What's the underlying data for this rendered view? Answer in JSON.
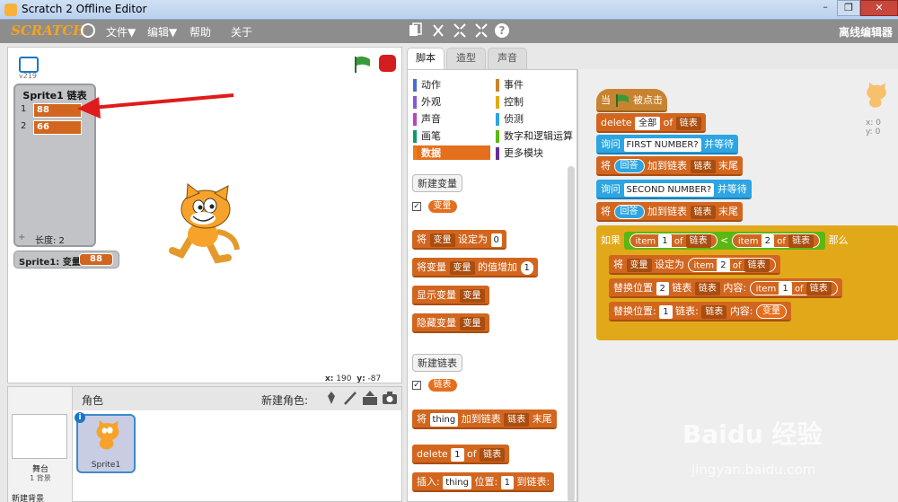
{
  "window": {
    "title": "Scratch 2 Offline Editor",
    "controls": [
      "–",
      "❐",
      "✕"
    ]
  },
  "menubar": {
    "logo": "SCRATCH",
    "items": [
      "文件▼",
      "编辑▼",
      "帮助",
      "关于"
    ],
    "right_label": "离线编辑器"
  },
  "stage": {
    "version": "v219",
    "list_watcher": {
      "title": "Sprite1 链表",
      "items": [
        {
          "index": "1",
          "value": "88"
        },
        {
          "index": "2",
          "value": "66"
        }
      ],
      "footer_plus": "+",
      "length_label": "长度: 2"
    },
    "var_watcher": {
      "name": "Sprite1: 变量",
      "value": "88"
    },
    "mouse_x_label": "x:",
    "mouse_x": "190",
    "mouse_y_label": "y:",
    "mouse_y": "-87"
  },
  "sprites_panel": {
    "title": "角色",
    "new_sprite_label": "新建角色:",
    "stage_label": "舞台",
    "stage_sub": "1 背景",
    "new_backdrop": "新建背景",
    "sprite_name": "Sprite1",
    "info_icon": "i"
  },
  "tabs": [
    {
      "label": "脚本",
      "active": true
    },
    {
      "label": "造型",
      "active": false
    },
    {
      "label": "声音",
      "active": false
    }
  ],
  "categories": [
    {
      "label": "动作",
      "color": "#4a6cd4"
    },
    {
      "label": "事件",
      "color": "#c88330"
    },
    {
      "label": "外观",
      "color": "#8a55d7"
    },
    {
      "label": "控制",
      "color": "#e1a91a"
    },
    {
      "label": "声音",
      "color": "#bb42c3"
    },
    {
      "label": "侦测",
      "color": "#2ca5e2"
    },
    {
      "label": "画笔",
      "color": "#0e9a6c"
    },
    {
      "label": "数字和逻辑运算",
      "color": "#5cb712"
    },
    {
      "label": "数据",
      "color": "#ee7d16",
      "selected": true
    },
    {
      "label": "更多模块",
      "color": "#632d99"
    }
  ],
  "palette": {
    "new_var_button": "新建变量",
    "var_reporter": "变量",
    "set_block": {
      "a": "将",
      "var": "变量",
      "b": "设定为",
      "val": "0"
    },
    "change_block": {
      "a": "将变量",
      "var": "变量",
      "b": "的值增加",
      "val": "1"
    },
    "show_block": {
      "a": "显示变量",
      "var": "变量"
    },
    "hide_block": {
      "a": "隐藏变量",
      "var": "变量"
    },
    "new_list_button": "新建链表",
    "list_reporter": "链表",
    "add_block": {
      "a": "将",
      "thing": "thing",
      "b": "加到链表",
      "list": "链表",
      "c": "末尾"
    },
    "delete_block": {
      "a": "delete",
      "num": "1",
      "b": "of",
      "list": "链表"
    },
    "insert_block": {
      "a": "插入:",
      "thing": "thing",
      "b": "位置:",
      "num": "1",
      "c": "到链表:"
    }
  },
  "script": {
    "hat": {
      "a": "当",
      "b": "被点击"
    },
    "s1": {
      "a": "delete",
      "dd": "全部",
      "b": "of",
      "list": "链表"
    },
    "s2": {
      "a": "询问",
      "text": "FIRST NUMBER?",
      "b": "并等待"
    },
    "s3": {
      "a": "将",
      "rep": "回答",
      "b": "加到链表",
      "list": "链表",
      "c": "末尾"
    },
    "s4": {
      "a": "询问",
      "text": "SECOND NUMBER?",
      "b": "并等待"
    },
    "s5": {
      "a": "将",
      "rep": "回答",
      "b": "加到链表",
      "list": "链表",
      "c": "末尾"
    },
    "if": {
      "a": "如果",
      "i1": "item",
      "n1": "1",
      "of1": "of",
      "l1": "链表",
      "lt": "<",
      "i2": "item",
      "n2": "2",
      "of2": "of",
      "l2": "链表",
      "then": "那么"
    },
    "i1": {
      "a": "将",
      "var": "变量",
      "b": "设定为",
      "item": "item",
      "num": "2",
      "of": "of",
      "list": "链表"
    },
    "i2": {
      "a": "替换位置",
      "num": "2",
      "b": "链表",
      "list": "链表",
      "c": "内容:",
      "item": "item",
      "n2": "1",
      "of": "of",
      "l2": "链表"
    },
    "i3": {
      "a": "替换位置:",
      "num": "1",
      "b": "链表:",
      "list": "链表",
      "c": "内容:",
      "var": "变量"
    }
  },
  "sprite_info": {
    "x": "x: 0",
    "y": "y: 0"
  },
  "watermark": {
    "main": "Baidu 经验",
    "sub": "jingyan.baidu.com"
  }
}
